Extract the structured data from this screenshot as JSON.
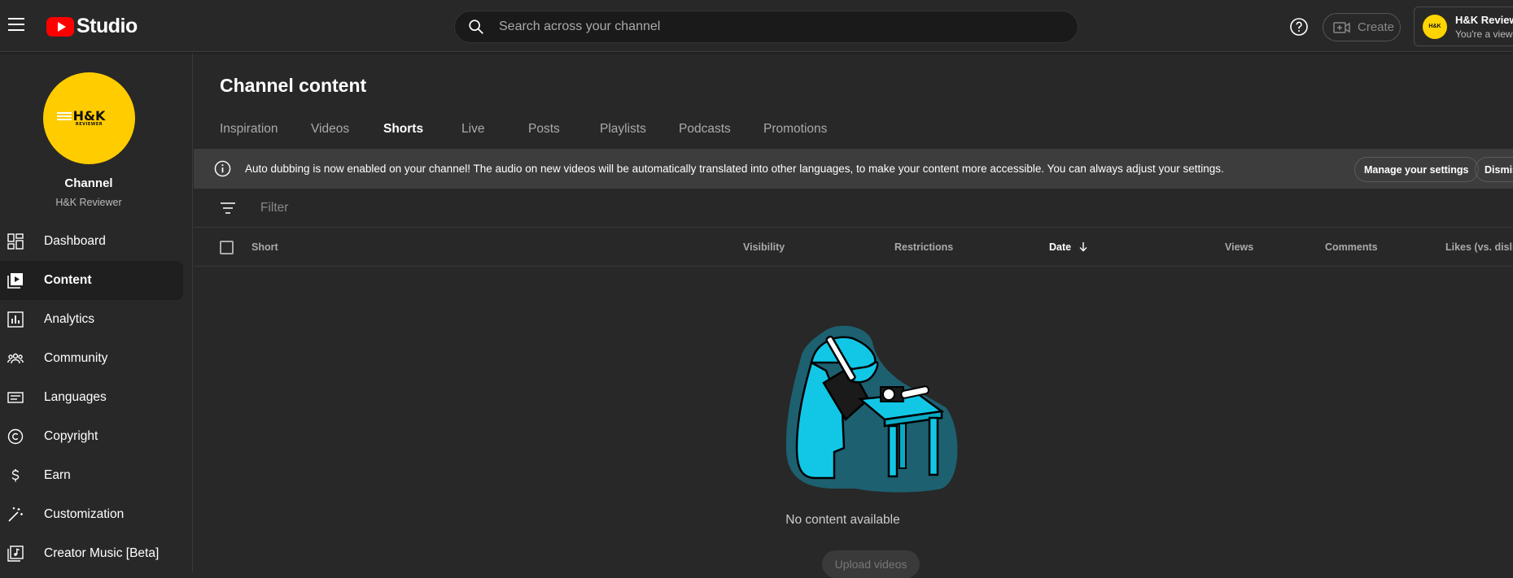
{
  "header": {
    "logo_text": "Studio",
    "search_placeholder": "Search across your channel",
    "create_label": "Create",
    "account_avatar_text": "H&K",
    "account_name": "H&K Reviewer",
    "account_role": "You're a viewer"
  },
  "sidebar": {
    "avatar_mark": "H&K",
    "avatar_sub": "REVIEWER",
    "channel_title": "Channel",
    "channel_name": "H&K Reviewer",
    "items": [
      {
        "label": "Dashboard",
        "icon": "dashboard-icon"
      },
      {
        "label": "Content",
        "icon": "content-icon",
        "active": true
      },
      {
        "label": "Analytics",
        "icon": "analytics-icon"
      },
      {
        "label": "Community",
        "icon": "community-icon"
      },
      {
        "label": "Languages",
        "icon": "languages-icon"
      },
      {
        "label": "Copyright",
        "icon": "copyright-icon"
      },
      {
        "label": "Earn",
        "icon": "earn-icon"
      },
      {
        "label": "Customization",
        "icon": "customization-icon"
      },
      {
        "label": "Creator Music [Beta]",
        "icon": "creator-music-icon"
      }
    ]
  },
  "main": {
    "title": "Channel content",
    "tabs": [
      "Inspiration",
      "Videos",
      "Shorts",
      "Live",
      "Posts",
      "Playlists",
      "Podcasts",
      "Promotions"
    ],
    "active_tab": "Shorts",
    "banner": {
      "text": "Auto dubbing is now enabled on your channel! The audio on new videos will be automatically translated into other languages, to make your content more accessible. You can always adjust your settings.",
      "manage_label": "Manage your settings",
      "dismiss_label": "Dismiss"
    },
    "filter_placeholder": "Filter",
    "columns": [
      "Short",
      "Visibility",
      "Restrictions",
      "Date",
      "Views",
      "Comments",
      "Likes (vs. dislikes)"
    ],
    "sorted_column": "Date",
    "empty_text": "No content available",
    "upload_label": "Upload videos"
  },
  "colors": {
    "background": "#282828",
    "brand_red": "#ff0000",
    "avatar_yellow": "#ffcc00",
    "illustration_cyan": "#12c7e6"
  }
}
